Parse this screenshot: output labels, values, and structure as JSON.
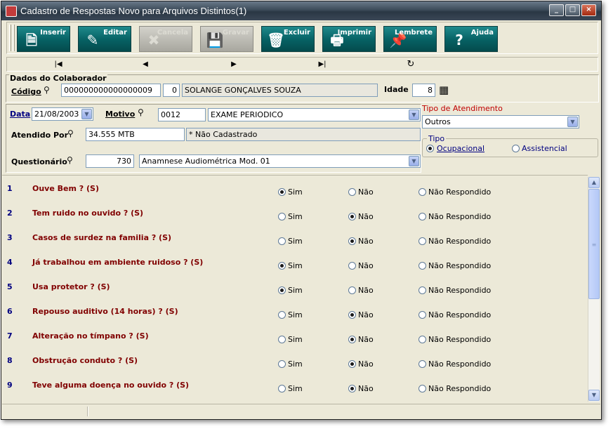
{
  "window": {
    "title": "Cadastro de Respostas Novo para Arquivos Distintos(1)",
    "controls": {
      "minimize": "_",
      "maximize": "□",
      "close": "×"
    }
  },
  "toolbar": {
    "buttons": [
      {
        "label": "Inserir",
        "icon": "insert-icon",
        "glyph": "🗎",
        "enabled": true
      },
      {
        "label": "Editar",
        "icon": "edit-icon",
        "glyph": "✎",
        "enabled": true
      },
      {
        "label": "Cancela",
        "icon": "cancel-icon",
        "glyph": "✖",
        "enabled": false
      },
      {
        "label": "Gravar",
        "icon": "save-icon",
        "glyph": "💾",
        "enabled": false
      },
      {
        "label": "Excluir",
        "icon": "trash-icon",
        "glyph": "🗑",
        "enabled": true
      },
      {
        "label": "Imprimir",
        "icon": "printer-icon",
        "glyph": "🖶",
        "enabled": true
      },
      {
        "label": "Lembrete",
        "icon": "note-icon",
        "glyph": "📌",
        "enabled": true
      },
      {
        "label": "Ajuda",
        "icon": "help-icon",
        "glyph": "?",
        "enabled": true
      }
    ]
  },
  "nav": {
    "first": "|◀",
    "prev": "◀",
    "next": "▶",
    "last": "▶|",
    "refresh": "↻"
  },
  "colaborador": {
    "group_title": "Dados do Colaborador",
    "codigo_label": "Código",
    "codigo": "000000000000000009",
    "seq": "0",
    "nome": "SOLANGE GONÇALVES SOUZA",
    "idade_label": "Idade",
    "idade": "8"
  },
  "form": {
    "data_label": "Data",
    "data": "21/08/2003",
    "motivo_label": "Motivo",
    "motivo_code": "0012",
    "motivo_desc": "EXAME PERIODICO",
    "atendido_label": "Atendido Por",
    "atendido": "34.555 MTB",
    "atendido_nome": "* Não Cadastrado",
    "questionario_label": "Questionário",
    "questionario_code": "730",
    "questionario_desc": "Anamnese Audiométrica Mod. 01"
  },
  "atendimento": {
    "tipo_title": "Tipo de Atendimento",
    "tipo_value": "Outros",
    "tipo_group_title": "Tipo",
    "ocupacional": "Ocupacional",
    "assistencial": "Assistencial",
    "selected": "ocupacional"
  },
  "options": {
    "sim": "Sim",
    "nao": "Não",
    "nr": "Não Respondido"
  },
  "questions": [
    {
      "num": "1",
      "text": "Ouve Bem ? (S)",
      "answer": "sim"
    },
    {
      "num": "2",
      "text": "Tem ruido no ouvido ? (S)",
      "answer": "nao"
    },
    {
      "num": "3",
      "text": "Casos de surdez na familia ? (S)",
      "answer": "nao"
    },
    {
      "num": "4",
      "text": "Já trabalhou em ambiente ruidoso ? (S)",
      "answer": "sim"
    },
    {
      "num": "5",
      "text": "Usa protetor ? (S)",
      "answer": "sim"
    },
    {
      "num": "6",
      "text": "Repouso auditivo (14 horas) ? (S)",
      "answer": "nao"
    },
    {
      "num": "7",
      "text": "Alteração no tímpano ? (S)",
      "answer": "nao"
    },
    {
      "num": "8",
      "text": "Obstrução conduto ? (S)",
      "answer": "nao"
    },
    {
      "num": "9",
      "text": "Teve alguma doença no ouvido ? (S)",
      "answer": "nao"
    }
  ],
  "scrollbar": {
    "up": "▲",
    "down": "▼",
    "grip": "≡"
  }
}
